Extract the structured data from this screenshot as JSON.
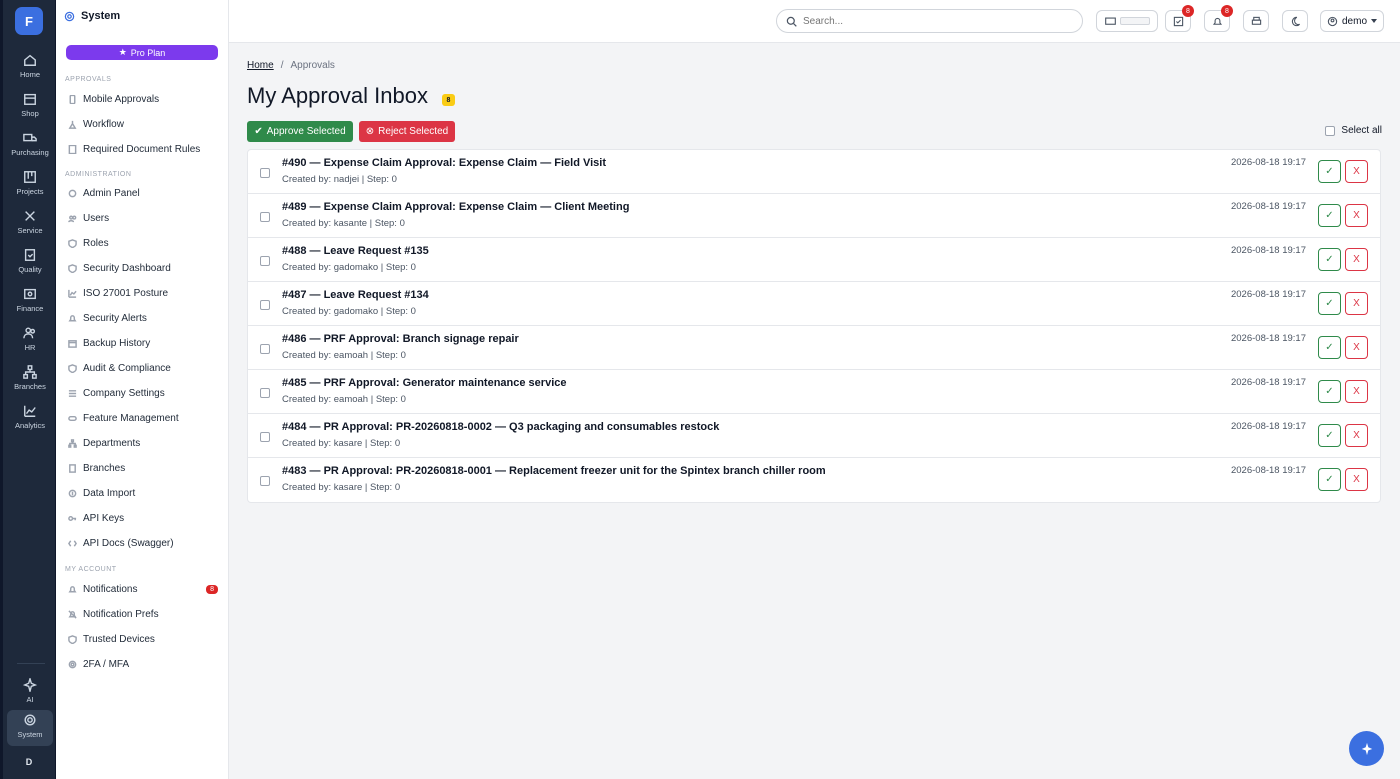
{
  "rail": {
    "logo": "F",
    "items": [
      {
        "label": "Home",
        "icon": "home-icon"
      },
      {
        "label": "Shop",
        "icon": "shop-icon"
      },
      {
        "label": "Purchasing",
        "icon": "truck-icon"
      },
      {
        "label": "Projects",
        "icon": "kanban-icon"
      },
      {
        "label": "Service",
        "icon": "tools-icon"
      },
      {
        "label": "Quality",
        "icon": "clipboard-icon"
      },
      {
        "label": "Finance",
        "icon": "finance-icon"
      },
      {
        "label": "HR",
        "icon": "people-icon"
      },
      {
        "label": "Branches",
        "icon": "branches-icon"
      },
      {
        "label": "Analytics",
        "icon": "chart-icon"
      },
      {
        "label": "AI",
        "icon": "sparkle-icon"
      },
      {
        "label": "System",
        "icon": "gear-icon"
      }
    ],
    "user_initial": "D"
  },
  "sidebar": {
    "title": "System",
    "plan": "Pro Plan",
    "sections": [
      {
        "label": "APPROVALS",
        "items": [
          "Mobile Approvals",
          "Workflow",
          "Required Document Rules"
        ]
      },
      {
        "label": "ADMINISTRATION",
        "items": [
          "Admin Panel",
          "Users",
          "Roles",
          "Security Dashboard",
          "ISO 27001 Posture",
          "Security Alerts",
          "Backup History",
          "Audit & Compliance",
          "Company Settings",
          "Feature Management",
          "Departments",
          "Branches",
          "Data Import",
          "API Keys",
          "API Docs (Swagger)"
        ]
      },
      {
        "label": "MY ACCOUNT",
        "items": [
          "Notifications",
          "Notification Prefs",
          "Trusted Devices",
          "2FA / MFA"
        ]
      }
    ],
    "notifications_badge": "8"
  },
  "topbar": {
    "search_placeholder": "Search...",
    "tasks_badge": "8",
    "bell_badge": "8",
    "user": "demo"
  },
  "main": {
    "breadcrumb": {
      "home": "Home",
      "current": "Approvals"
    },
    "title": "My Approval Inbox",
    "count": "8",
    "approve_label": "Approve Selected",
    "reject_label": "Reject Selected",
    "select_all": "Select all",
    "approve_icon": "✓",
    "reject_icon": "X",
    "rows": [
      {
        "title": "#490 — Expense Claim Approval: Expense Claim — Field Visit",
        "meta": "Created by: nadjei | Step: 0",
        "date": "2026-08-18 19:17"
      },
      {
        "title": "#489 — Expense Claim Approval: Expense Claim — Client Meeting",
        "meta": "Created by: kasante | Step: 0",
        "date": "2026-08-18 19:17"
      },
      {
        "title": "#488 — Leave Request #135",
        "meta": "Created by: gadomako | Step: 0",
        "date": "2026-08-18 19:17"
      },
      {
        "title": "#487 — Leave Request #134",
        "meta": "Created by: gadomako | Step: 0",
        "date": "2026-08-18 19:17"
      },
      {
        "title": "#486 — PRF Approval: Branch signage repair",
        "meta": "Created by: eamoah | Step: 0",
        "date": "2026-08-18 19:17"
      },
      {
        "title": "#485 — PRF Approval: Generator maintenance service",
        "meta": "Created by: eamoah | Step: 0",
        "date": "2026-08-18 19:17"
      },
      {
        "title": "#484 — PR Approval: PR-20260818-0002 — Q3 packaging and consumables restock",
        "meta": "Created by: kasare | Step: 0",
        "date": "2026-08-18 19:17"
      },
      {
        "title": "#483 — PR Approval: PR-20260818-0001 — Replacement freezer unit for the Spintex branch chiller room",
        "meta": "Created by: kasare | Step: 0",
        "date": "2026-08-18 19:17"
      }
    ]
  }
}
